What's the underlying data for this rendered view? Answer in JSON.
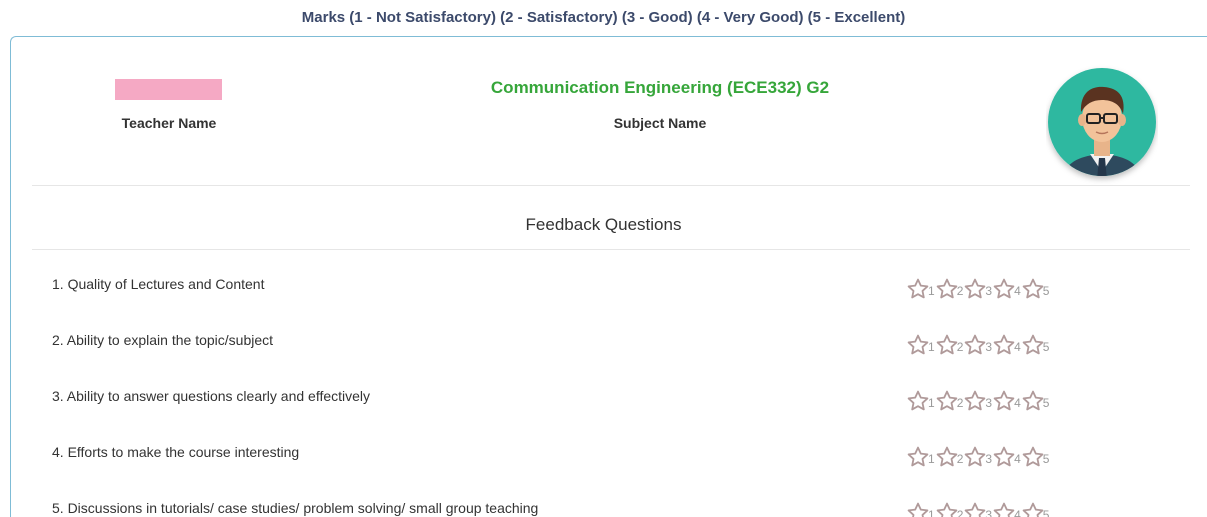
{
  "legend": {
    "text": "Marks (1 - Not Satisfactory) (2 - Satisfactory) (3 - Good) (4 - Very Good) (5 - Excellent)"
  },
  "teacher": {
    "label": "Teacher Name"
  },
  "subject": {
    "title": "Communication Engineering (ECE332) G2",
    "label": "Subject Name"
  },
  "avatar": {
    "icon": "teacher-avatar-icon"
  },
  "feedback": {
    "title": "Feedback Questions",
    "rating_labels": [
      "1",
      "2",
      "3",
      "4",
      "5"
    ],
    "star_color": "#b09a9a",
    "questions": [
      "1. Quality of Lectures and Content",
      "2. Ability to explain the topic/subject",
      "3. Ability to answer questions clearly and effectively",
      "4. Efforts to make the course interesting",
      "5. Discussions in tutorials/ case studies/ problem solving/ small group teaching"
    ]
  },
  "colors": {
    "accent_green": "#36a63a",
    "legend_navy": "#3c4a6b",
    "card_border": "#7fbcd6",
    "redaction_pink": "#f5a9c4"
  }
}
